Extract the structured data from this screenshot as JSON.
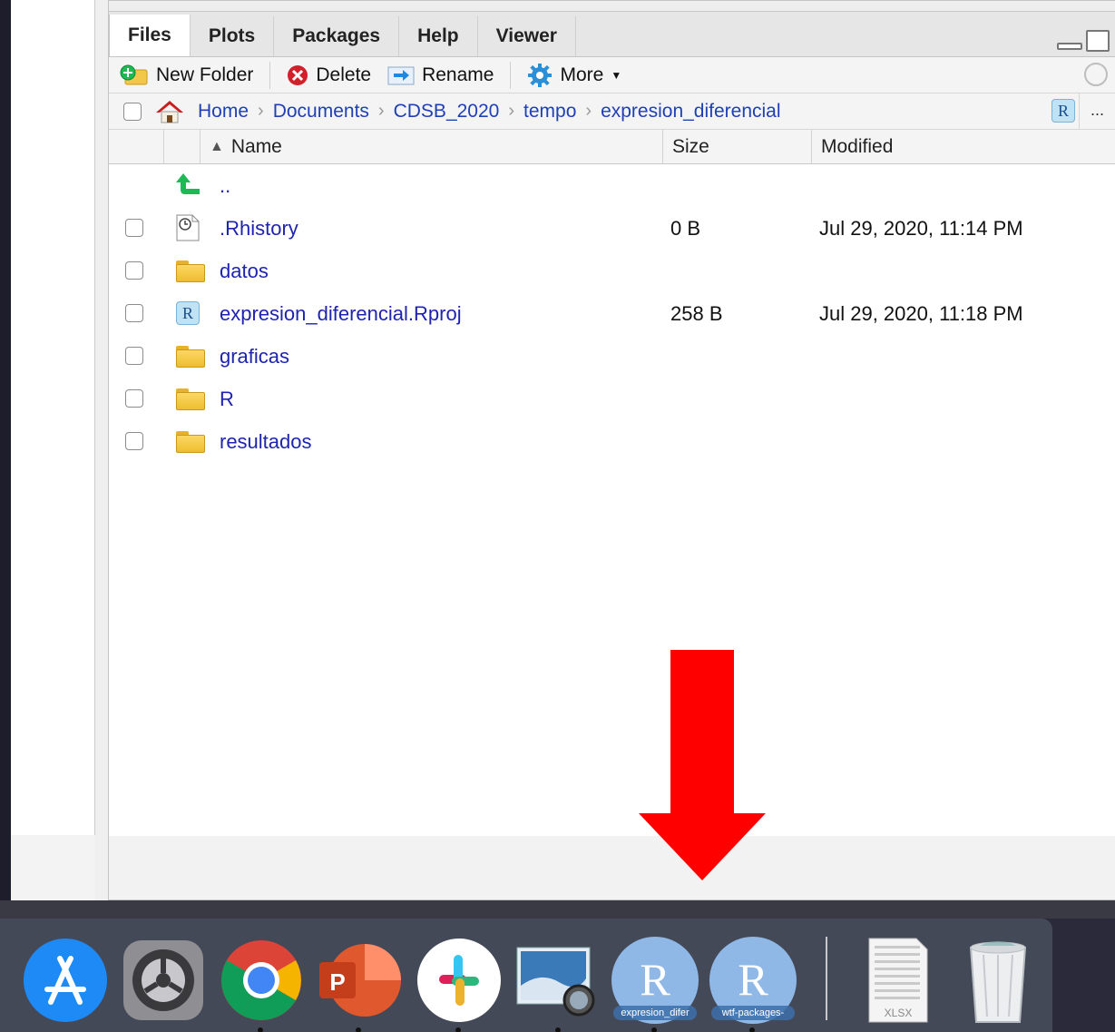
{
  "tabs": [
    {
      "label": "Files",
      "active": true
    },
    {
      "label": "Plots"
    },
    {
      "label": "Packages"
    },
    {
      "label": "Help"
    },
    {
      "label": "Viewer"
    }
  ],
  "toolbar": {
    "new_folder": "New Folder",
    "delete": "Delete",
    "rename": "Rename",
    "more": "More"
  },
  "path": {
    "home": "Home",
    "crumbs": [
      "Documents",
      "CDSB_2020",
      "tempo",
      "expresion_diferencial"
    ],
    "more": "..."
  },
  "columns": {
    "name": "Name",
    "size": "Size",
    "modified": "Modified"
  },
  "parent_dir": "..",
  "files": [
    {
      "name": ".Rhistory",
      "size": "0 B",
      "modified": "Jul 29, 2020, 11:14 PM",
      "icon": "history-file-icon"
    },
    {
      "name": "datos",
      "size": "",
      "modified": "",
      "icon": "folder-icon"
    },
    {
      "name": "expresion_diferencial.Rproj",
      "size": "258 B",
      "modified": "Jul 29, 2020, 11:18 PM",
      "icon": "rproj-icon"
    },
    {
      "name": "graficas",
      "size": "",
      "modified": "",
      "icon": "folder-icon"
    },
    {
      "name": "R",
      "size": "",
      "modified": "",
      "icon": "folder-icon"
    },
    {
      "name": "resultados",
      "size": "",
      "modified": "",
      "icon": "folder-icon"
    }
  ],
  "dock": {
    "apps": [
      "app-store-icon",
      "system-preferences-icon",
      "chrome-icon",
      "powerpoint-icon",
      "slack-icon",
      "preview-icon",
      "r-icon",
      "r-icon",
      "xlsx-file-icon",
      "trash-icon"
    ],
    "r_label_1": "expresion_difer",
    "r_label_2": "wtf-packages-",
    "r_glyph": "R",
    "xlsx_label": "XLSX"
  },
  "colors": {
    "link": "#1f24b0",
    "arrow": "#ff0000",
    "accent_green": "#1db954"
  }
}
